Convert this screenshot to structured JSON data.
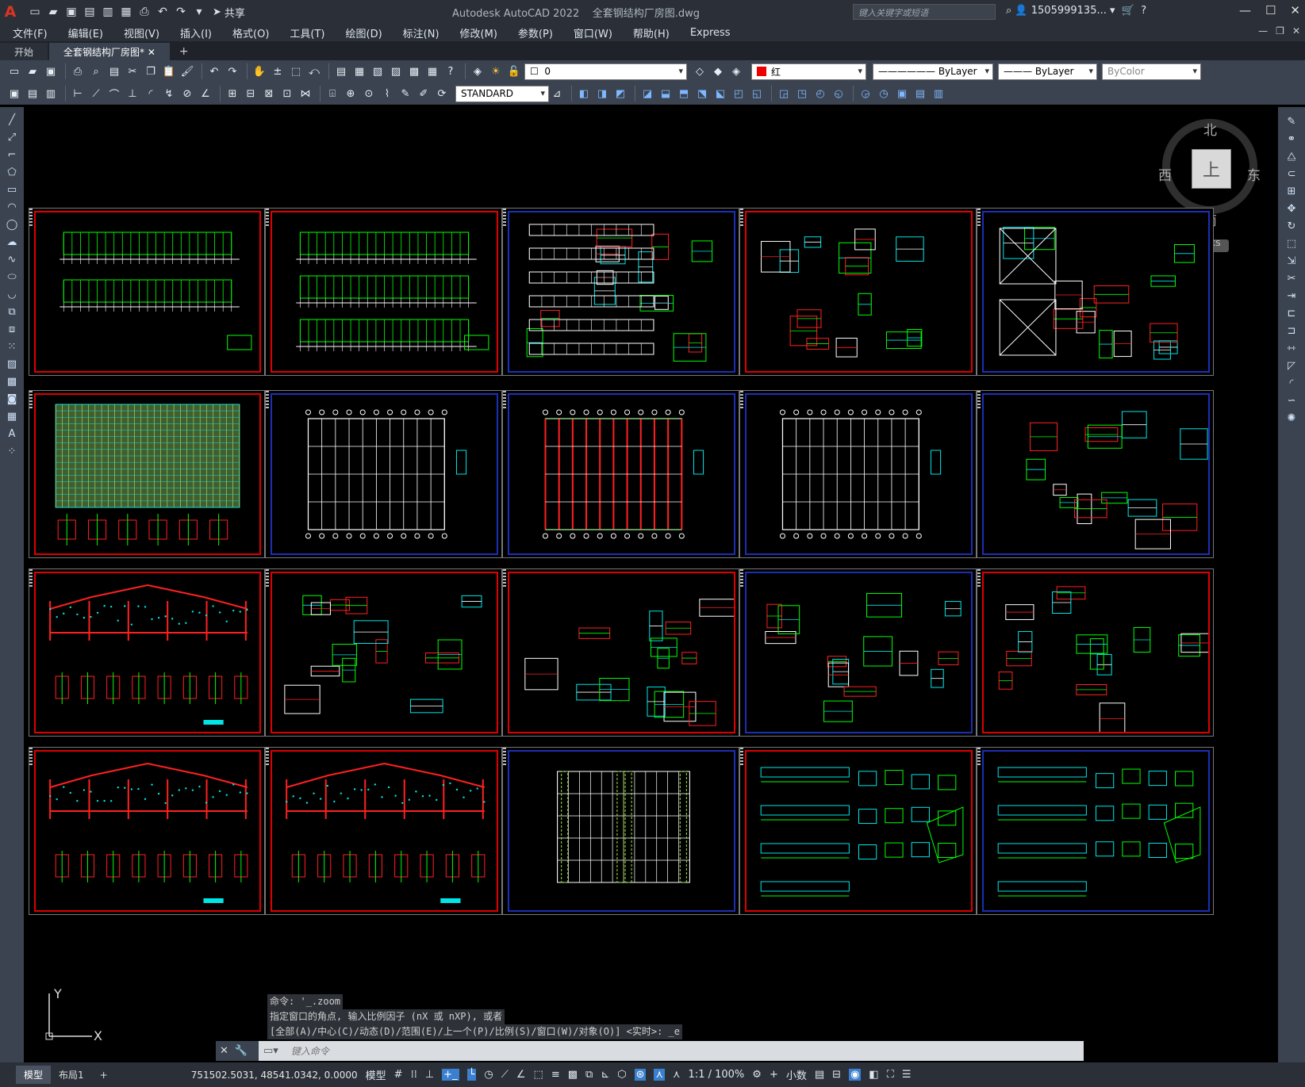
{
  "title_bar": {
    "app_name": "Autodesk AutoCAD 2022",
    "file_name": "全套钢结构厂房图.dwg",
    "search_placeholder": "键入关键字或短语",
    "user": "1505999135...",
    "share_label": "共享"
  },
  "menu": {
    "items": [
      "文件(F)",
      "编辑(E)",
      "视图(V)",
      "插入(I)",
      "格式(O)",
      "工具(T)",
      "绘图(D)",
      "标注(N)",
      "修改(M)",
      "参数(P)",
      "窗口(W)",
      "帮助(H)",
      "Express"
    ]
  },
  "tabs": [
    {
      "label": "开始"
    },
    {
      "label": "全套钢结构厂房图*"
    }
  ],
  "toolbar": {
    "layer_value": "0",
    "color_value": "红",
    "linetype_value": "ByLayer",
    "lineweight_value": "ByLayer",
    "plotstyle_value": "ByColor",
    "textstyle_value": "STANDARD"
  },
  "viewcube": {
    "north": "北",
    "south": "南",
    "east": "东",
    "west": "西",
    "top": "上",
    "wcs": "WCS"
  },
  "ucs": {
    "x": "X",
    "y": "Y"
  },
  "command": {
    "history": [
      "命令: '_.zoom",
      "指定窗口的角点, 输入比例因子 (nX 或 nXP), 或者",
      "[全部(A)/中心(C)/动态(D)/范围(E)/上一个(P)/比例(S)/窗口(W)/对象(O)] <实时>: _e"
    ],
    "placeholder": "键入命令"
  },
  "status": {
    "tabs": [
      "模型",
      "布局1"
    ],
    "coordinates": "751502.5031, 48541.0342, 0.0000",
    "space": "模型",
    "annotation_scale": "1:1 / 100%",
    "units": "小数"
  },
  "colors": {
    "drawing_bg": "#000000",
    "frame_red": "#dd0000",
    "frame_blue": "#1c2fb4",
    "green": "#00ff00",
    "cyan": "#00e5e5",
    "red": "#ff2020",
    "white": "#ffffff"
  }
}
